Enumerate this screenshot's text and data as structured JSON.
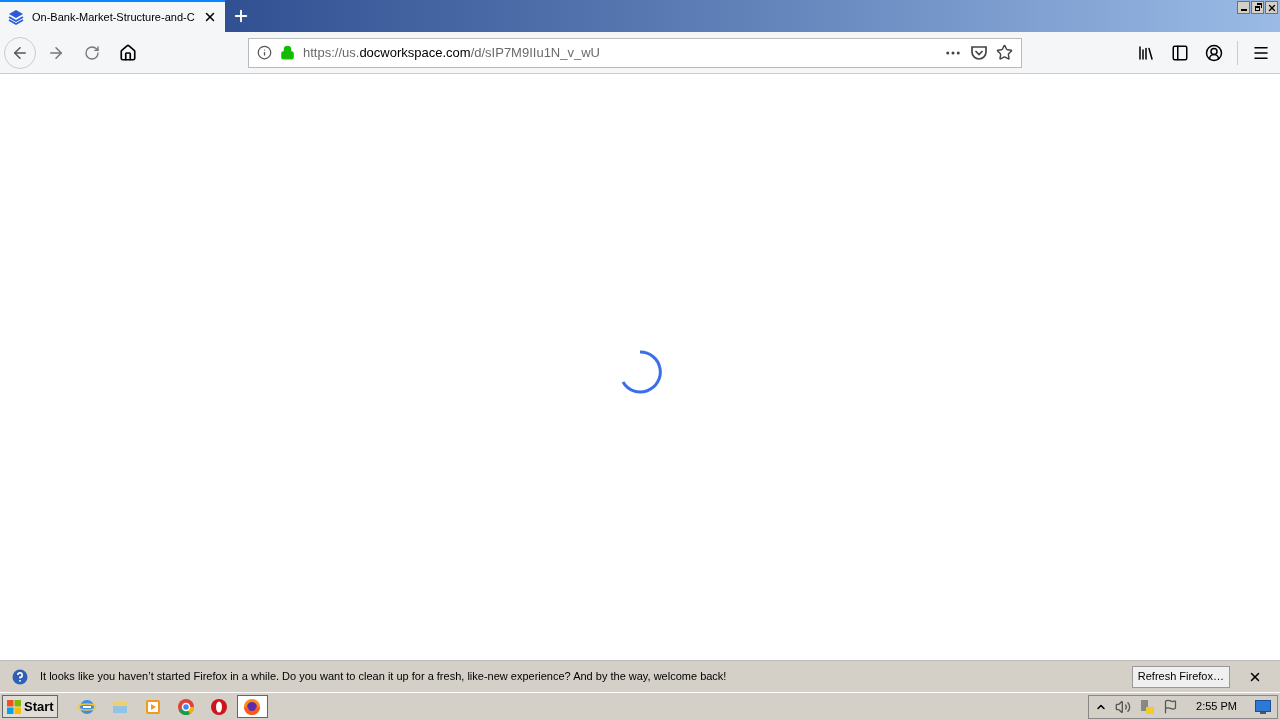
{
  "tabs": [
    {
      "title": "On-Bank-Market-Structure-and-C",
      "selected": true
    }
  ],
  "address_bar": {
    "scheme": "https://us.",
    "host": "docworkspace.com",
    "path": "/d/sIP7M9IIu1N_v_wU"
  },
  "notification": {
    "message": "It looks like you haven’t started Firefox in a while. Do you want to clean it up for a fresh, like-new experience? And by the way, welcome back!",
    "button": "Refresh Firefox…"
  },
  "taskbar": {
    "start": "Start",
    "apps": [
      {
        "kind": "ie",
        "selected": false
      },
      {
        "kind": "explorer",
        "selected": false
      },
      {
        "kind": "media",
        "selected": false
      },
      {
        "kind": "chrome",
        "selected": false
      },
      {
        "kind": "opera",
        "selected": false
      },
      {
        "kind": "firefox",
        "selected": true
      }
    ],
    "clock": "2:55 PM"
  }
}
